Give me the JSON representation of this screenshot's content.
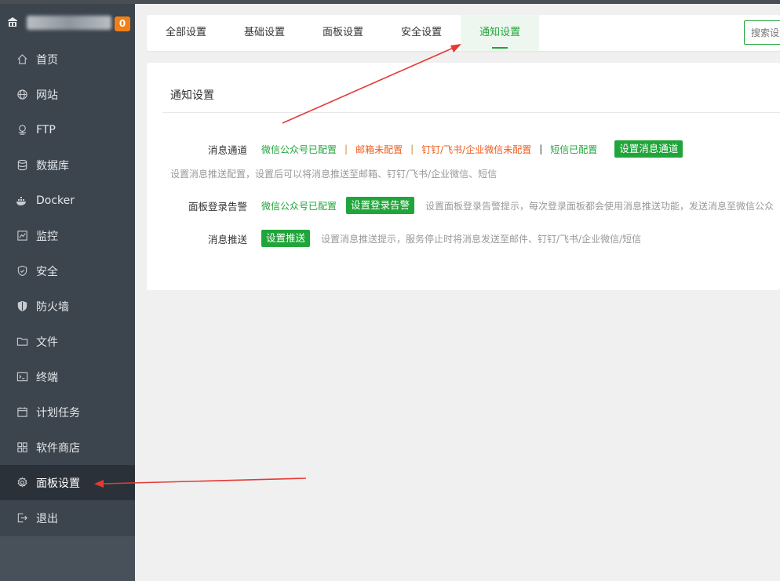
{
  "sidebar": {
    "badge": "0",
    "items": [
      {
        "label": "首页",
        "icon": "home-icon"
      },
      {
        "label": "网站",
        "icon": "globe-icon"
      },
      {
        "label": "FTP",
        "icon": "ftp-icon"
      },
      {
        "label": "数据库",
        "icon": "database-icon"
      },
      {
        "label": "Docker",
        "icon": "docker-icon"
      },
      {
        "label": "监控",
        "icon": "monitor-icon"
      },
      {
        "label": "安全",
        "icon": "shield-check-icon"
      },
      {
        "label": "防火墙",
        "icon": "firewall-shield-icon"
      },
      {
        "label": "文件",
        "icon": "folder-icon"
      },
      {
        "label": "终端",
        "icon": "terminal-icon"
      },
      {
        "label": "计划任务",
        "icon": "calendar-icon"
      },
      {
        "label": "软件商店",
        "icon": "apps-grid-icon"
      },
      {
        "label": "面板设置",
        "icon": "gear-icon"
      },
      {
        "label": "退出",
        "icon": "logout-icon"
      }
    ],
    "active_index": 12
  },
  "tabs": {
    "items": [
      "全部设置",
      "基础设置",
      "面板设置",
      "安全设置",
      "通知设置"
    ],
    "active_index": 4,
    "search_placeholder": "搜索设置"
  },
  "panel": {
    "title": "通知设置",
    "channel": {
      "label": "消息通道",
      "wechat": "微信公众号已配置",
      "sep1": "|",
      "email": "邮箱未配置",
      "sep2": "|",
      "dingtalk": "钉钉/飞书/企业微信未配置",
      "sep3": "|",
      "sms": "短信已配置",
      "button": "设置消息通道",
      "hint": "设置消息推送配置，设置后可以将消息推送至邮箱、钉钉/飞书/企业微信、短信"
    },
    "login_alert": {
      "label": "面板登录告警",
      "wechat": "微信公众号已配置",
      "button": "设置登录告警",
      "hint": "设置面板登录告警提示，每次登录面板都会使用消息推送功能，发送消息至微信公众"
    },
    "push": {
      "label": "消息推送",
      "button": "设置推送",
      "hint": "设置消息推送提示，服务停止时将消息发送至邮件、钉钉/飞书/企业微信/短信"
    }
  },
  "colors": {
    "accent": "#20a53a",
    "warning": "#ef5b1a",
    "sidebar_bg": "#3c444d",
    "badge": "#ef7f1a",
    "arrow": "#e53935"
  }
}
